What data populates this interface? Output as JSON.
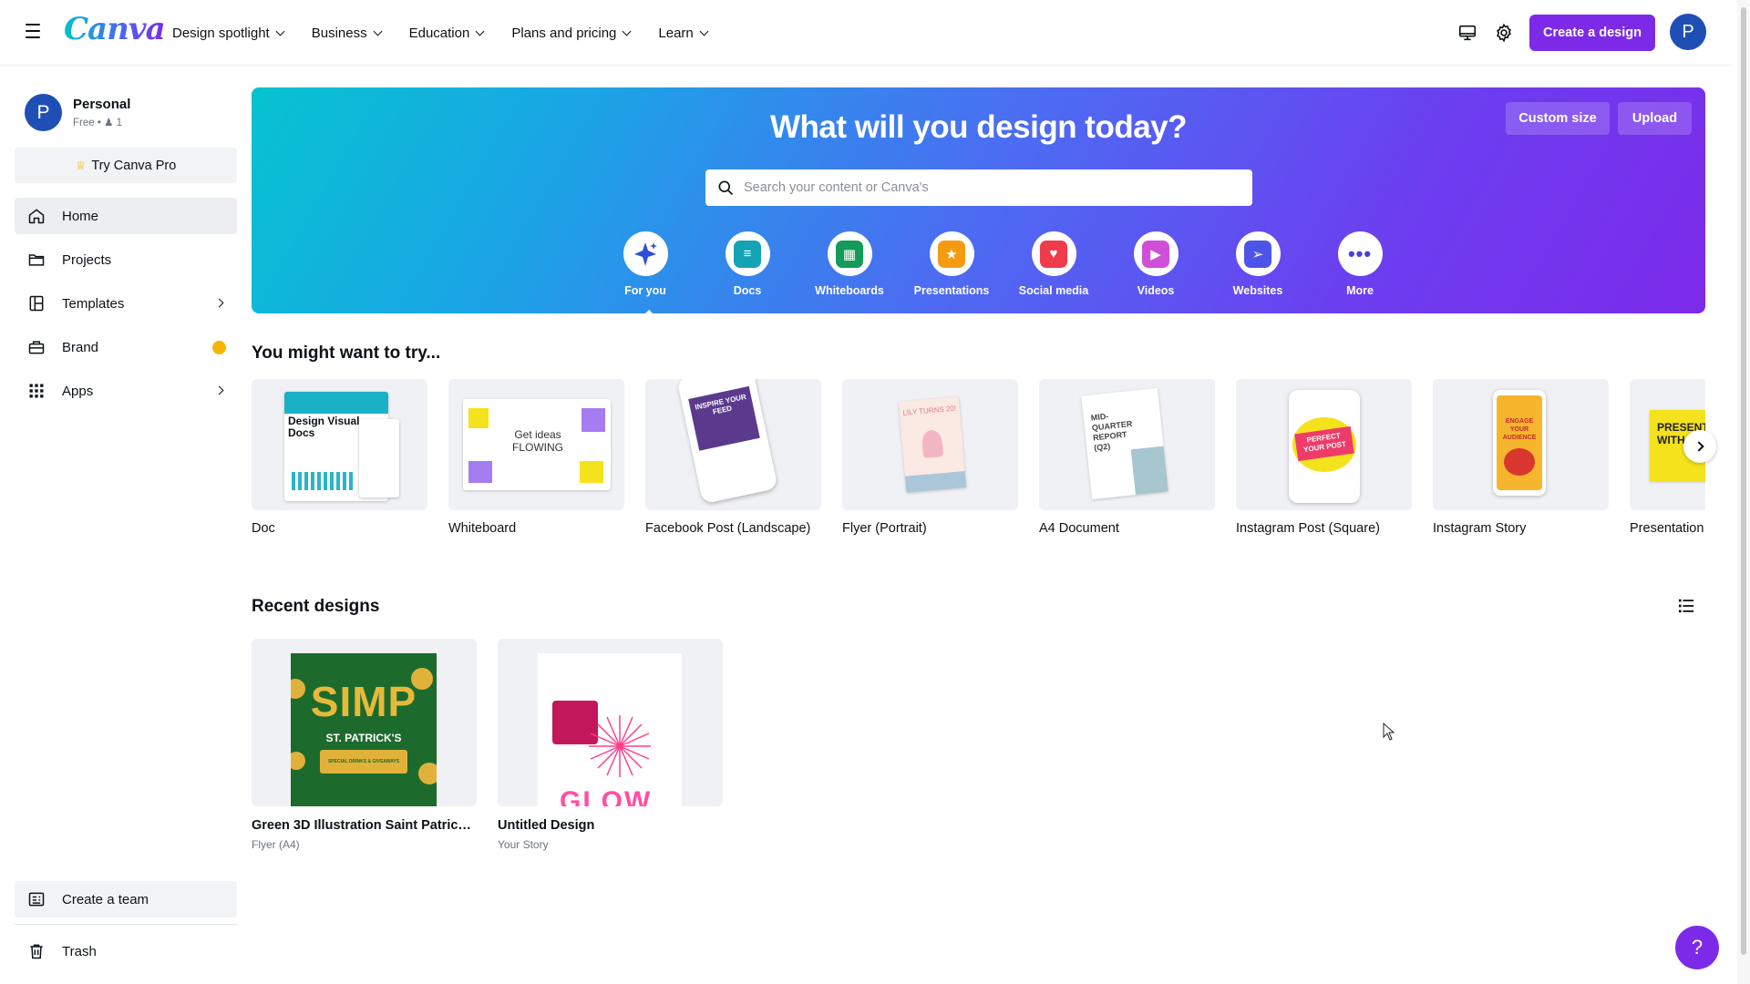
{
  "app": {
    "logo": "Canva"
  },
  "topnav": {
    "items": [
      {
        "label": "Design spotlight"
      },
      {
        "label": "Business"
      },
      {
        "label": "Education"
      },
      {
        "label": "Plans and pricing"
      },
      {
        "label": "Learn"
      }
    ],
    "create_button": "Create a design",
    "avatar_initial": "P"
  },
  "sidebar": {
    "account": {
      "initial": "P",
      "name": "Personal",
      "plan": "Free",
      "members": "1"
    },
    "try_pro": "Try Canva Pro",
    "items": [
      {
        "label": "Home",
        "icon": "home-icon"
      },
      {
        "label": "Projects",
        "icon": "folder-icon"
      },
      {
        "label": "Templates",
        "icon": "templates-icon"
      },
      {
        "label": "Brand",
        "icon": "brand-icon"
      },
      {
        "label": "Apps",
        "icon": "apps-grid-icon"
      }
    ],
    "bottom": [
      {
        "label": "Create a team",
        "icon": "team-icon"
      },
      {
        "label": "Trash",
        "icon": "trash-icon"
      }
    ]
  },
  "hero": {
    "title": "What will you design today?",
    "custom_size": "Custom size",
    "upload": "Upload",
    "search_placeholder": "Search your content or Canva's",
    "categories": [
      {
        "label": "For you",
        "icon": "sparkle-icon",
        "color": "#2f4fd8"
      },
      {
        "label": "Docs",
        "icon": "docs-icon",
        "color": "#13a3b5"
      },
      {
        "label": "Whiteboards",
        "icon": "whiteboard-icon",
        "color": "#149b5a"
      },
      {
        "label": "Presentations",
        "icon": "presentation-icon",
        "color": "#f59b12"
      },
      {
        "label": "Social media",
        "icon": "heart-icon",
        "color": "#ef3b4a"
      },
      {
        "label": "Videos",
        "icon": "video-icon",
        "color": "#d04fd8"
      },
      {
        "label": "Websites",
        "icon": "cursor-icon",
        "color": "#4d55e8"
      },
      {
        "label": "More",
        "icon": "more-icon",
        "color": "#4a3fd6"
      }
    ]
  },
  "try_section": {
    "heading": "You might want to try...",
    "cards": [
      {
        "label": "Doc",
        "thumb_text": "Design Visual Docs"
      },
      {
        "label": "Whiteboard",
        "thumb_text": "Get ideas FLOWING"
      },
      {
        "label": "Facebook Post (Landscape)",
        "thumb_text": "INSPIRE YOUR FEED"
      },
      {
        "label": "Flyer (Portrait)",
        "thumb_text": "LILY TURNS 20!"
      },
      {
        "label": "A4 Document",
        "thumb_text": "MID-QUARTER REPORT (Q2)"
      },
      {
        "label": "Instagram Post (Square)",
        "thumb_text": "PERFECT YOUR POST"
      },
      {
        "label": "Instagram Story",
        "thumb_text": "ENGAGE YOUR AUDIENCE"
      },
      {
        "label": "Presentation",
        "thumb_text": "PRESENT WITH"
      }
    ]
  },
  "recent": {
    "heading": "Recent designs",
    "items": [
      {
        "title": "Green 3D Illustration Saint Patrick'...",
        "type": "Flyer (A4)",
        "thumb_big": "SIMP",
        "thumb_sub": "ST. PATRICK'S",
        "thumb_small": "SPECIAL DRINKS & GIVEAWAYS"
      },
      {
        "title": "Untitled Design",
        "type": "Your Story",
        "thumb_text": "GLOW"
      }
    ]
  },
  "help": "?",
  "colors": {
    "accent": "#7d2ae8",
    "avatar": "#1f4fb4",
    "brand_badge": "#f7b500"
  }
}
